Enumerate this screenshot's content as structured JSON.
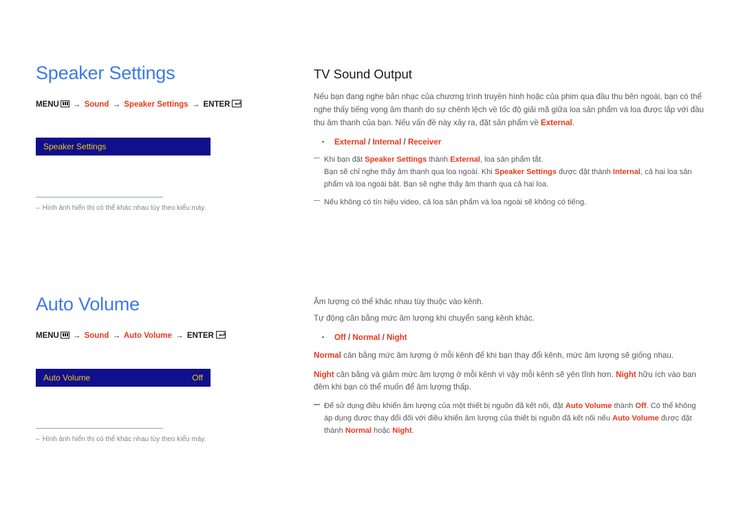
{
  "left": {
    "speaker": {
      "title": "Speaker Settings",
      "breadcrumb": {
        "menu": "MENU",
        "menu_icon": "menu-grid-icon",
        "arrow": "→",
        "path1": "Sound",
        "path2": "Speaker Settings",
        "enter": "ENTER",
        "enter_icon": "enter-return-icon"
      },
      "osd": {
        "label": "Speaker Settings",
        "value": ""
      },
      "footnote": {
        "dash": "–",
        "text": "Hình ảnh hiển thị có thể khác nhau tùy theo kiểu máy."
      }
    },
    "auto_volume": {
      "title": "Auto Volume",
      "breadcrumb": {
        "menu": "MENU",
        "menu_icon": "menu-grid-icon",
        "arrow": "→",
        "path1": "Sound",
        "path2": "Auto Volume",
        "enter": "ENTER",
        "enter_icon": "enter-return-icon"
      },
      "osd": {
        "label": "Auto Volume",
        "value": "Off"
      },
      "footnote": {
        "dash": "–",
        "text": "Hình ảnh hiển thị có thể khác nhau tùy theo kiểu máy."
      }
    }
  },
  "right": {
    "tv_sound_output": {
      "title": "TV Sound Output",
      "intro_a": "Nếu bạn đang nghe bản nhạc của chương trình truyền hình hoặc của phim qua đầu thu bên ngoài, bạn có thể nghe thấy tiếng vọng âm thanh do sự chênh lệch về tốc độ giải mã giữa loa sản phẩm và loa được lắp với đầu thu âm thanh của bạn. Nếu vấn đề này xảy ra, đặt sản phẩm về ",
      "intro_b": "External",
      "intro_c": ".",
      "options": {
        "o1": "External",
        "sep1": " / ",
        "o2": "Internal",
        "sep2": " / ",
        "o3": "Receiver"
      },
      "note1": {
        "p1": "Khi bạn đặt ",
        "r1": "Speaker Settings",
        "p2": " thành ",
        "r2": "External",
        "p3": ", loa sản phẩm tắt.",
        "l2_p1": "Bạn sẽ chỉ nghe thấy âm thanh qua loa ngoài. Khi ",
        "l2_r1": "Speaker Settings",
        "l2_p2": " được đặt thành ",
        "l2_r2": "Internal",
        "l2_p3": ", cả hai loa sản phẩm và loa ngoài bật. Bạn sẽ nghe thấy âm thanh qua cả hai loa."
      },
      "note2": "Nếu không có tín hiệu video, cả loa sản phẩm và loa ngoài sẽ không có tiếng."
    },
    "auto_volume": {
      "p1": "Âm lượng có thể khác nhau tùy thuộc vào kênh.",
      "p2": "Tự động cân bằng mức âm lượng khi chuyển sang kênh khác.",
      "options": {
        "o1": "Off",
        "sep1": " / ",
        "o2": "Normal",
        "sep2": " / ",
        "o3": "Night"
      },
      "normal": {
        "r1": "Normal",
        "p1": " cân bằng mức âm lượng ở mỗi kênh để khi bạn thay đổi kênh, mức âm lượng sẽ giống nhau."
      },
      "night": {
        "r1": "Night",
        "p1": " cân bằng và giảm mức âm lượng ở mỗi kênh vì vậy mỗi kênh sẽ yên tĩnh hơn. ",
        "r2": "Night",
        "p2": " hữu ích vào ban đêm khi bạn có thể muốn để âm lượng thấp."
      },
      "note": {
        "p1": "Để sử dụng điều khiển âm lượng của một thiết bị nguồn đã kết nối, đặt ",
        "r1": "Auto Volume",
        "p2": " thành ",
        "r2": "Off",
        "p3": ". Có thể không áp dụng được thay đổi đối với điều khiển âm lượng của thiết bị nguồn đã kết nối nếu ",
        "r3": "Auto Volume",
        "p4": " được đặt thành ",
        "r4": "Normal",
        "p5": " hoặc ",
        "r5": "Night",
        "p6": "."
      }
    }
  },
  "colors": {
    "heading_blue": "#3d79e8",
    "accent_red": "#e8381a",
    "osd_bg": "#10108c",
    "osd_text": "#f5c518",
    "body_gray": "#58595b",
    "footnote_gray": "#7d858f"
  }
}
